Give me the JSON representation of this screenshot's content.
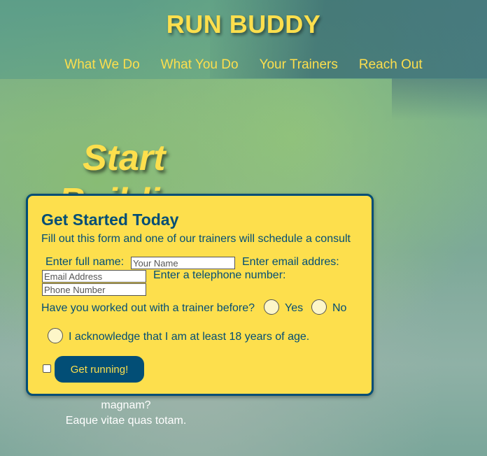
{
  "header": {
    "title": "RUN BUDDY",
    "nav": [
      "What We Do",
      "What You Do",
      "Your Trainers",
      "Reach Out"
    ]
  },
  "hero": {
    "heading_line1": "Start",
    "heading_line2": "Building",
    "sub_line1": "magnam?",
    "sub_line2": "Eaque vitae quas totam."
  },
  "form": {
    "title": "Get Started Today",
    "description": "Fill out this form and one of our trainers will schedule a consult",
    "name_label": "Enter full name:",
    "name_placeholder": "Your Name",
    "email_label": "Enter email addres:",
    "email_placeholder": "Email Address",
    "phone_label": "Enter a telephone number:",
    "phone_placeholder": "Phone Number",
    "trainer_question": "Have you worked out with a trainer before?",
    "yes_label": "Yes",
    "no_label": "No",
    "age_ack_label": "I acknowledge that I am at least 18 years of age.",
    "submit_label": "Get running!"
  },
  "colors": {
    "accent_yellow": "#fddf4d",
    "brand_blue": "#024e76"
  }
}
